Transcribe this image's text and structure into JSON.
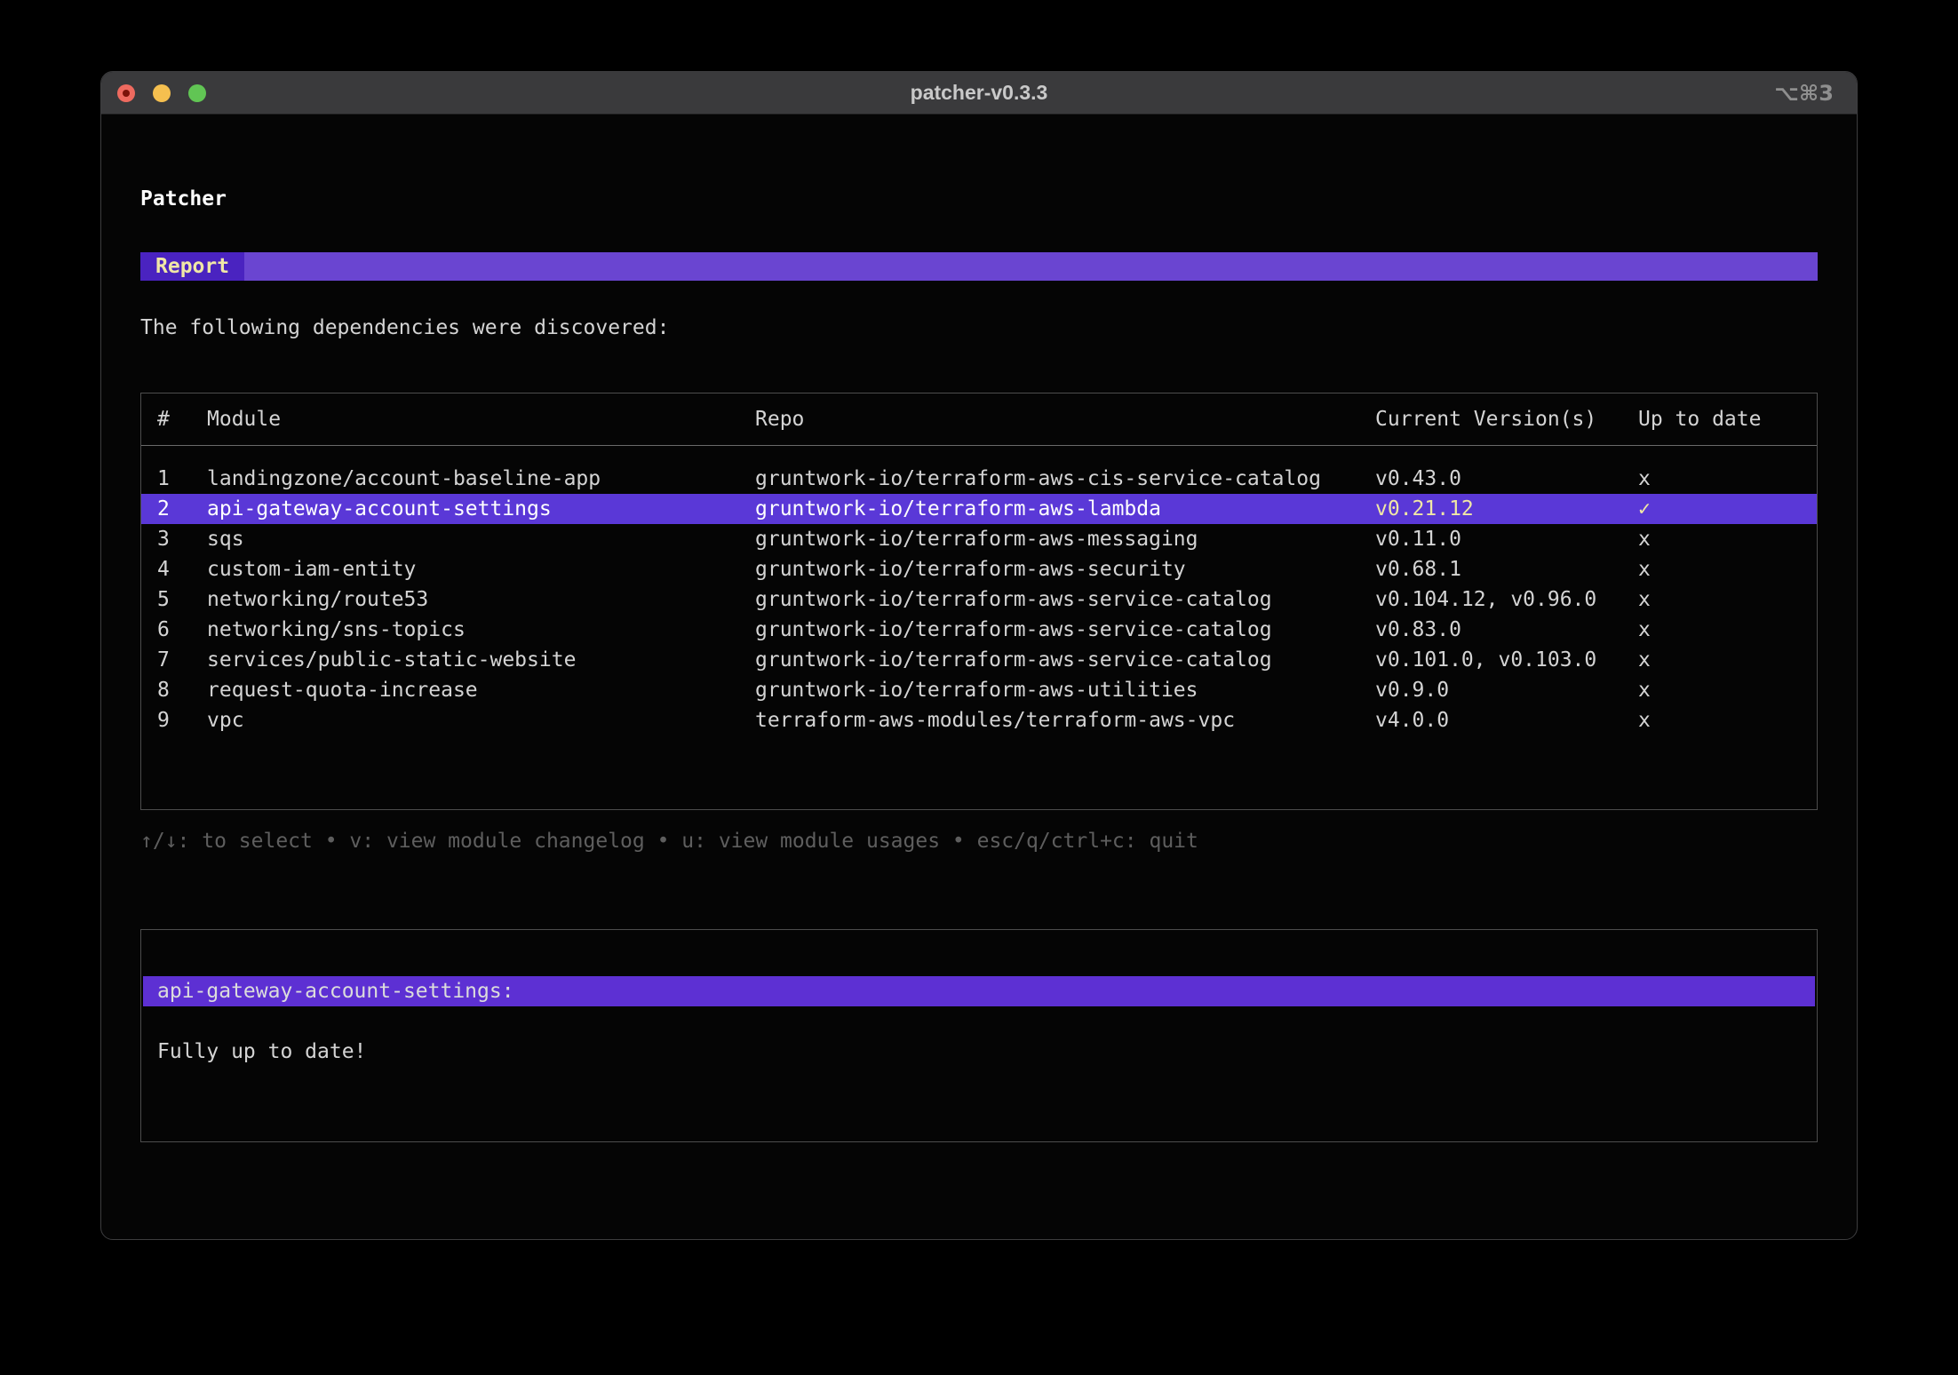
{
  "colors": {
    "outer-bg": "#000000",
    "window-bg": "#050505",
    "titlebar-bg": "#3a3a3c",
    "traffic-red": "#ee6a5f",
    "traffic-yellow": "#f5bf4f",
    "traffic-green": "#61c554",
    "text-default": "#d4d4d4",
    "text-dim": "#5e5e5e",
    "pale-yellow": "#f0e7a6",
    "report-tab-bg": "#4a23c0",
    "report-bar-bg": "#6a45d1",
    "row-selected-bg": "#5a38d7",
    "detail-bar-bg": "#5d30d3"
  },
  "window": {
    "title": "patcher-v0.3.3",
    "shortcut": "⌥⌘3"
  },
  "app": {
    "heading": "Patcher",
    "tab_label": "Report",
    "intro": "The following dependencies were discovered:"
  },
  "table": {
    "headers": [
      "#",
      "Module",
      "Repo",
      "Current Version(s)",
      "Up to date"
    ],
    "rows": [
      {
        "num": "1",
        "module": "landingzone/account-baseline-app",
        "repo": "gruntwork-io/terraform-aws-cis-service-catalog",
        "version": "v0.43.0",
        "status": "x",
        "selected": false
      },
      {
        "num": "2",
        "module": "api-gateway-account-settings",
        "repo": "gruntwork-io/terraform-aws-lambda",
        "version": "v0.21.12",
        "status": "✓",
        "selected": true
      },
      {
        "num": "3",
        "module": "sqs",
        "repo": "gruntwork-io/terraform-aws-messaging",
        "version": "v0.11.0",
        "status": "x",
        "selected": false
      },
      {
        "num": "4",
        "module": "custom-iam-entity",
        "repo": "gruntwork-io/terraform-aws-security",
        "version": "v0.68.1",
        "status": "x",
        "selected": false
      },
      {
        "num": "5",
        "module": "networking/route53",
        "repo": "gruntwork-io/terraform-aws-service-catalog",
        "version": "v0.104.12, v0.96.0",
        "status": "x",
        "selected": false
      },
      {
        "num": "6",
        "module": "networking/sns-topics",
        "repo": "gruntwork-io/terraform-aws-service-catalog",
        "version": "v0.83.0",
        "status": "x",
        "selected": false
      },
      {
        "num": "7",
        "module": "services/public-static-website",
        "repo": "gruntwork-io/terraform-aws-service-catalog",
        "version": "v0.101.0, v0.103.0",
        "status": "x",
        "selected": false
      },
      {
        "num": "8",
        "module": "request-quota-increase",
        "repo": "gruntwork-io/terraform-aws-utilities",
        "version": "v0.9.0",
        "status": "x",
        "selected": false
      },
      {
        "num": "9",
        "module": "vpc",
        "repo": "terraform-aws-modules/terraform-aws-vpc",
        "version": "v4.0.0",
        "status": "x",
        "selected": false
      }
    ]
  },
  "help": {
    "separator": "•",
    "items": [
      "↑/↓: to select",
      "v: view module changelog",
      "u: view module usages",
      "esc/q/ctrl+c: quit"
    ]
  },
  "detail_panel": {
    "title": "api-gateway-account-settings:",
    "body": "Fully up to date!"
  }
}
